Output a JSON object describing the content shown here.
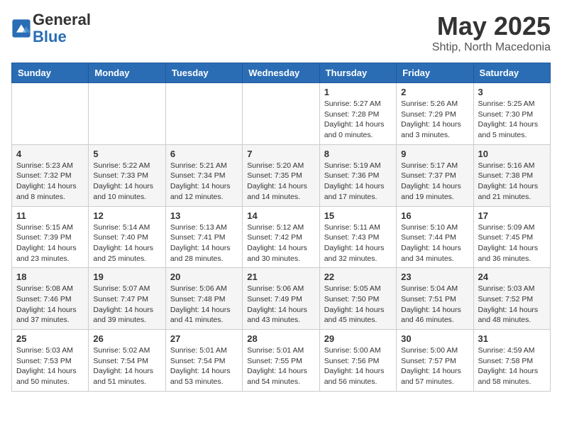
{
  "header": {
    "logo_line1": "General",
    "logo_line2": "Blue",
    "month": "May 2025",
    "location": "Shtip, North Macedonia"
  },
  "weekdays": [
    "Sunday",
    "Monday",
    "Tuesday",
    "Wednesday",
    "Thursday",
    "Friday",
    "Saturday"
  ],
  "weeks": [
    [
      {
        "day": "",
        "info": ""
      },
      {
        "day": "",
        "info": ""
      },
      {
        "day": "",
        "info": ""
      },
      {
        "day": "",
        "info": ""
      },
      {
        "day": "1",
        "info": "Sunrise: 5:27 AM\nSunset: 7:28 PM\nDaylight: 14 hours\nand 0 minutes."
      },
      {
        "day": "2",
        "info": "Sunrise: 5:26 AM\nSunset: 7:29 PM\nDaylight: 14 hours\nand 3 minutes."
      },
      {
        "day": "3",
        "info": "Sunrise: 5:25 AM\nSunset: 7:30 PM\nDaylight: 14 hours\nand 5 minutes."
      }
    ],
    [
      {
        "day": "4",
        "info": "Sunrise: 5:23 AM\nSunset: 7:32 PM\nDaylight: 14 hours\nand 8 minutes."
      },
      {
        "day": "5",
        "info": "Sunrise: 5:22 AM\nSunset: 7:33 PM\nDaylight: 14 hours\nand 10 minutes."
      },
      {
        "day": "6",
        "info": "Sunrise: 5:21 AM\nSunset: 7:34 PM\nDaylight: 14 hours\nand 12 minutes."
      },
      {
        "day": "7",
        "info": "Sunrise: 5:20 AM\nSunset: 7:35 PM\nDaylight: 14 hours\nand 14 minutes."
      },
      {
        "day": "8",
        "info": "Sunrise: 5:19 AM\nSunset: 7:36 PM\nDaylight: 14 hours\nand 17 minutes."
      },
      {
        "day": "9",
        "info": "Sunrise: 5:17 AM\nSunset: 7:37 PM\nDaylight: 14 hours\nand 19 minutes."
      },
      {
        "day": "10",
        "info": "Sunrise: 5:16 AM\nSunset: 7:38 PM\nDaylight: 14 hours\nand 21 minutes."
      }
    ],
    [
      {
        "day": "11",
        "info": "Sunrise: 5:15 AM\nSunset: 7:39 PM\nDaylight: 14 hours\nand 23 minutes."
      },
      {
        "day": "12",
        "info": "Sunrise: 5:14 AM\nSunset: 7:40 PM\nDaylight: 14 hours\nand 25 minutes."
      },
      {
        "day": "13",
        "info": "Sunrise: 5:13 AM\nSunset: 7:41 PM\nDaylight: 14 hours\nand 28 minutes."
      },
      {
        "day": "14",
        "info": "Sunrise: 5:12 AM\nSunset: 7:42 PM\nDaylight: 14 hours\nand 30 minutes."
      },
      {
        "day": "15",
        "info": "Sunrise: 5:11 AM\nSunset: 7:43 PM\nDaylight: 14 hours\nand 32 minutes."
      },
      {
        "day": "16",
        "info": "Sunrise: 5:10 AM\nSunset: 7:44 PM\nDaylight: 14 hours\nand 34 minutes."
      },
      {
        "day": "17",
        "info": "Sunrise: 5:09 AM\nSunset: 7:45 PM\nDaylight: 14 hours\nand 36 minutes."
      }
    ],
    [
      {
        "day": "18",
        "info": "Sunrise: 5:08 AM\nSunset: 7:46 PM\nDaylight: 14 hours\nand 37 minutes."
      },
      {
        "day": "19",
        "info": "Sunrise: 5:07 AM\nSunset: 7:47 PM\nDaylight: 14 hours\nand 39 minutes."
      },
      {
        "day": "20",
        "info": "Sunrise: 5:06 AM\nSunset: 7:48 PM\nDaylight: 14 hours\nand 41 minutes."
      },
      {
        "day": "21",
        "info": "Sunrise: 5:06 AM\nSunset: 7:49 PM\nDaylight: 14 hours\nand 43 minutes."
      },
      {
        "day": "22",
        "info": "Sunrise: 5:05 AM\nSunset: 7:50 PM\nDaylight: 14 hours\nand 45 minutes."
      },
      {
        "day": "23",
        "info": "Sunrise: 5:04 AM\nSunset: 7:51 PM\nDaylight: 14 hours\nand 46 minutes."
      },
      {
        "day": "24",
        "info": "Sunrise: 5:03 AM\nSunset: 7:52 PM\nDaylight: 14 hours\nand 48 minutes."
      }
    ],
    [
      {
        "day": "25",
        "info": "Sunrise: 5:03 AM\nSunset: 7:53 PM\nDaylight: 14 hours\nand 50 minutes."
      },
      {
        "day": "26",
        "info": "Sunrise: 5:02 AM\nSunset: 7:54 PM\nDaylight: 14 hours\nand 51 minutes."
      },
      {
        "day": "27",
        "info": "Sunrise: 5:01 AM\nSunset: 7:54 PM\nDaylight: 14 hours\nand 53 minutes."
      },
      {
        "day": "28",
        "info": "Sunrise: 5:01 AM\nSunset: 7:55 PM\nDaylight: 14 hours\nand 54 minutes."
      },
      {
        "day": "29",
        "info": "Sunrise: 5:00 AM\nSunset: 7:56 PM\nDaylight: 14 hours\nand 56 minutes."
      },
      {
        "day": "30",
        "info": "Sunrise: 5:00 AM\nSunset: 7:57 PM\nDaylight: 14 hours\nand 57 minutes."
      },
      {
        "day": "31",
        "info": "Sunrise: 4:59 AM\nSunset: 7:58 PM\nDaylight: 14 hours\nand 58 minutes."
      }
    ]
  ]
}
